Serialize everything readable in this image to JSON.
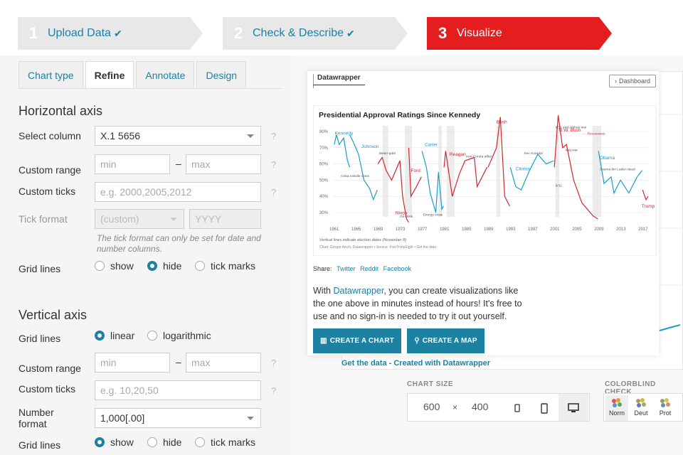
{
  "steps": [
    {
      "num": "1",
      "label": "Upload Data",
      "check": "✔"
    },
    {
      "num": "2",
      "label": "Check & Describe",
      "check": "✔"
    },
    {
      "num": "3",
      "label": "Visualize",
      "check": ""
    }
  ],
  "tabs": [
    "Chart type",
    "Refine",
    "Annotate",
    "Design"
  ],
  "horizontal": {
    "title": "Horizontal axis",
    "select_label": "Select column",
    "select_value": "X.1 5656",
    "range_label": "Custom range",
    "min_ph": "min",
    "max_ph": "max",
    "dash": "–",
    "ticks_label": "Custom ticks",
    "ticks_ph": "e.g. 2000,2005,2012",
    "format_label": "Tick format",
    "format_value": "(custom)",
    "format_ph": "YYYY",
    "format_note": "The tick format can only be set for date and number columns.",
    "grid_label": "Grid lines",
    "grid_options": [
      "show",
      "hide",
      "tick marks"
    ],
    "grid_selected": "hide",
    "help": "?"
  },
  "vertical": {
    "title": "Vertical axis",
    "grid_label": "Grid lines",
    "scale_options": [
      "linear",
      "logarithmic"
    ],
    "scale_selected": "linear",
    "range_label": "Custom range",
    "min_ph": "min",
    "max_ph": "max",
    "dash": "–",
    "ticks_label": "Custom ticks",
    "ticks_ph": "e.g. 10,20,50",
    "number_label": "Number format",
    "number_value": "1,000[.00]",
    "grid2_label": "Grid lines",
    "grid_options": [
      "show",
      "hide",
      "tick marks"
    ],
    "grid_selected": "show",
    "help": "?"
  },
  "popup": {
    "tab": "Datawrapper",
    "dashboard": "Dashboard",
    "share_label": "Share:",
    "share_links": [
      "Twitter",
      "Reddit",
      "Facebook"
    ],
    "text_pre": "With ",
    "text_link": "Datawrapper",
    "text_post": ", you can create visualizations like the one above in minutes instead of hours! It's free to use and no sign-in is needed to try it out yourself.",
    "btn_chart": "CREATE A CHART",
    "btn_map": "CREATE A MAP"
  },
  "chart_data": {
    "type": "line",
    "title": "Presidential Approval Ratings Since Kennedy",
    "ylim": [
      20,
      85
    ],
    "yticks": [
      "80%",
      "70%",
      "60%",
      "50%",
      "40%",
      "30%"
    ],
    "xticks": [
      "1961",
      "1965",
      "1969",
      "1973",
      "1977",
      "1981",
      "1985",
      "1989",
      "1993",
      "1997",
      "2001",
      "2005",
      "2009",
      "2013",
      "2017"
    ],
    "presidents": [
      "Kennedy",
      "Johnson",
      "Nixon",
      "Ford",
      "Carter",
      "Reagan",
      "Bush",
      "Clinton",
      "G.W. Bush",
      "Obama",
      "Trump"
    ],
    "annotations": [
      "Cuba missile crisis",
      "Water-gate",
      "Oil crisis",
      "Energy crisis",
      "Iran-Contra affair",
      "Sex scandal",
      "9/11 and Afghan war",
      "Iraq war",
      "9/11",
      "Osama bin Laden dead",
      "← Recessions"
    ],
    "footnote": "Vertical lines indicate election dates (November 8)",
    "source": "Chart: Gregor Aisch, Datawrapper • Source: FiveThirtyEight • Get the data",
    "colors": {
      "dem": "#1b9dc6",
      "rep": "#d0262e"
    }
  },
  "bg": {
    "source_line": "Get the data - Created with Datawrapper"
  },
  "size": {
    "label": "CHART SIZE",
    "width": "600",
    "x": "×",
    "height": "400"
  },
  "colorblind": {
    "label": "COLORBLIND CHECK",
    "options": [
      "Norm",
      "Deut",
      "Prot"
    ]
  },
  "colors": {
    "accent": "#1d81a2",
    "active_step": "#e41e1e",
    "step_bg": "#e8e8e8"
  }
}
